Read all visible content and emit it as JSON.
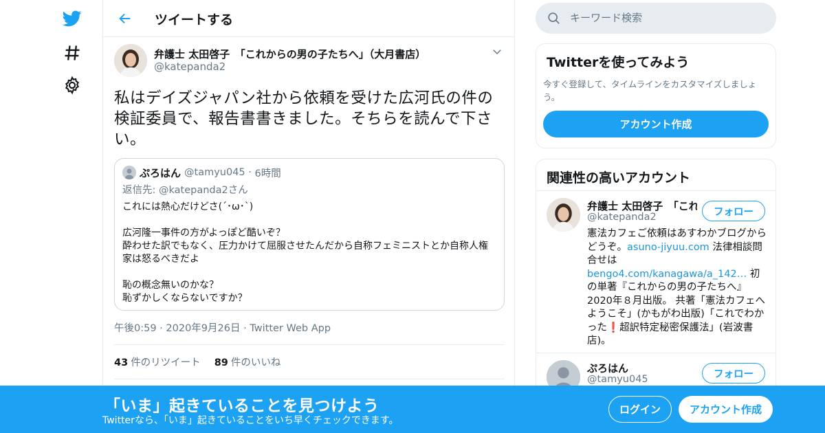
{
  "colors": {
    "brand": "#1da1f2",
    "link": "#1b95e0",
    "muted": "#657786",
    "alert": "#e0245e"
  },
  "nav": {
    "icons": [
      "twitter-bird-icon",
      "hashtag-icon",
      "gear-icon"
    ]
  },
  "header": {
    "title": "ツイートする"
  },
  "tweet": {
    "author_name": "弁護士 太田啓子　「これからの男の子たちへ」（大月書店）",
    "author_handle": "@katepanda2",
    "text": "私はデイズジャパン社から依頼を受けた広河氏の件の検証委員で、報告書書きました。そちらを読んで下さい。",
    "quote": {
      "name": "ぷろはん",
      "handle": "@tamyu045",
      "time": "6時間",
      "reply_to": "返信先: @katepanda2さん",
      "body": "これには熱心だけどさ(´･ω･`)\n\n広河隆一事件の方がよっぽど酷いぞ？\n酔わせた訳でもなく、圧力かけて屈服させたんだから自称フェミニストとか自称人権家は怒るべきだよ\n\n恥の概念無いのかな？\n恥ずかしくならないですか？"
    },
    "time": "午後0:59",
    "date": "2020年9月26日",
    "client": "Twitter Web App",
    "retweets": "43",
    "retweets_label": "件のリツイート",
    "likes": "89",
    "likes_label": "件のいいね"
  },
  "search": {
    "placeholder": "キーワード検索"
  },
  "signup_card": {
    "title": "Twitterを使ってみよう",
    "subtitle": "今すぐ登録して、タイムラインをカスタマイズしましょう。",
    "button": "アカウント作成"
  },
  "related": {
    "title": "関連性の高いアカウント",
    "accounts": [
      {
        "name": "弁護士 太田啓子　「これからの男の子たちへ」",
        "handle": "@katepanda2",
        "follow": "フォロー",
        "bio_1": "憲法カフェご依頼はあすわかブログからどうぞ。",
        "bio_link_1": "asuno-jiyuu.com",
        "bio_2": " 法律相談問合せは",
        "bio_link_2": "bengo4.com/kanagawa/a_142…",
        "bio_3": " 初の単著『これからの男の子たちへ』2020年８月出版。 共著「憲法カフェへようこそ」(かもがわ出版)「これでわかった",
        "bio_excl": "❗",
        "bio_4": "超訳特定秘密保護法」(岩波書店)。"
      },
      {
        "name": "ぷろはん",
        "handle": "@tamyu045",
        "follow": "フォロー"
      }
    ]
  },
  "banner": {
    "title": "「いま」起きていることを見つけよう",
    "subtitle": "Twitterなら、「いま」起きていることをいち早くチェックできます。",
    "login": "ログイン",
    "signup": "アカウント作成"
  }
}
